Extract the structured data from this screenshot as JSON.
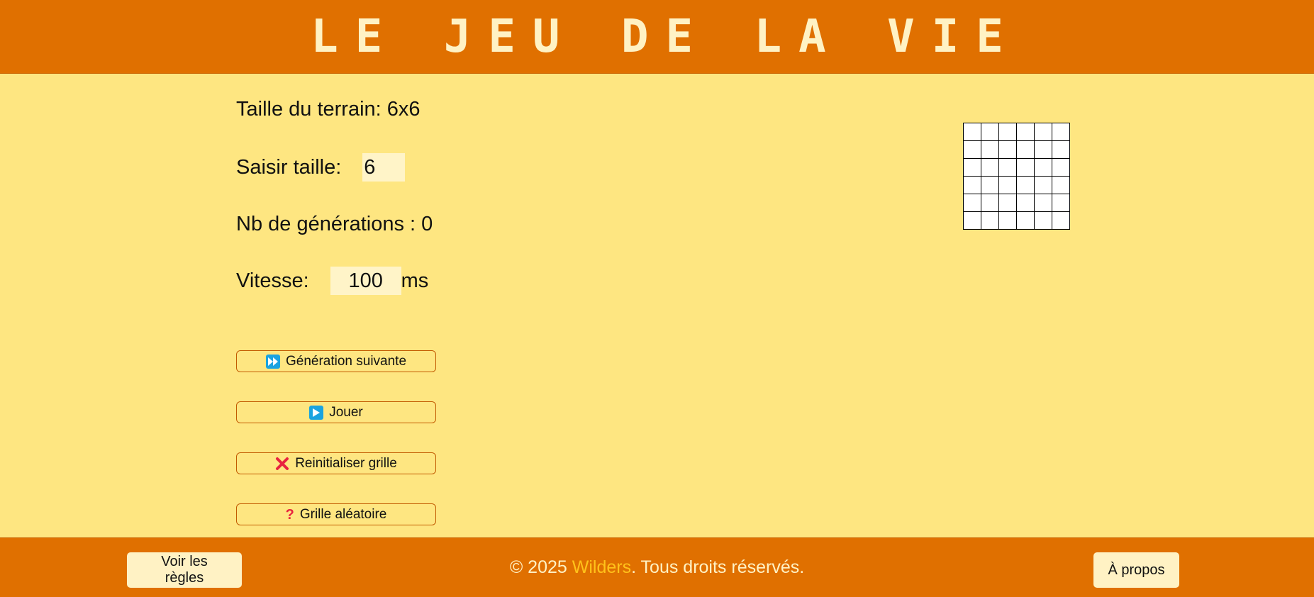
{
  "header": {
    "title": "LE JEU DE LA VIE"
  },
  "controls": {
    "terrain_label": "Taille du terrain: 6x6",
    "size_label": "Saisir taille:",
    "size_value": "6",
    "generations_label": "Nb de générations : 0",
    "speed_label": "Vitesse:",
    "speed_value": "100",
    "speed_unit": "ms"
  },
  "buttons": {
    "next": {
      "icon": "fast-forward-icon",
      "label": "Génération suivante"
    },
    "play": {
      "icon": "play-icon",
      "label": "Jouer"
    },
    "reset": {
      "icon": "red-cross-icon",
      "label": "Reinitialiser grille"
    },
    "random": {
      "icon": "red-question-icon",
      "label": "Grille aléatoire"
    }
  },
  "grid": {
    "rows": 6,
    "cols": 6
  },
  "footer": {
    "rules_button": "Voir les règles",
    "copyright_prefix": "© 2025 ",
    "brand": "Wilders",
    "copyright_suffix": ". Tous droits réservés.",
    "about_button": "À propos"
  },
  "colors": {
    "header_bg": "#e07000",
    "page_bg": "#fee681",
    "title": "#fff2c4",
    "brand": "#ffc21a",
    "button_border": "#c25a00",
    "icon_blue": "#1aa3e0",
    "icon_red": "#e8233f"
  }
}
